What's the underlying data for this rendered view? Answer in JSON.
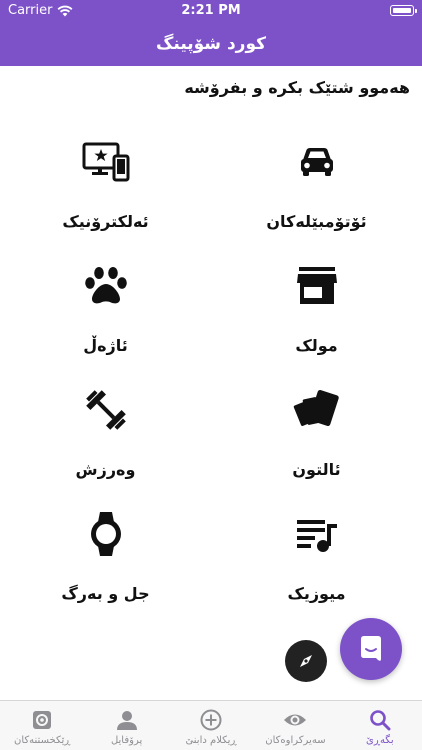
{
  "status_bar": {
    "carrier": "Carrier",
    "time": "2:21 PM"
  },
  "nav": {
    "title": "کورد شۆپینگ"
  },
  "subtitle": "هەموو شتێک بکرە و بفرۆشە",
  "categories": [
    {
      "label": "ئۆتۆمبێلەکان",
      "icon": "car-icon"
    },
    {
      "label": "ئەلکترۆنیک",
      "icon": "devices-icon"
    },
    {
      "label": "مولک",
      "icon": "store-icon"
    },
    {
      "label": "ئاژەڵ",
      "icon": "paw-icon"
    },
    {
      "label": "ئالتون",
      "icon": "gold-icon"
    },
    {
      "label": "وەرزش",
      "icon": "dumbbell-icon"
    },
    {
      "label": "میوزیک",
      "icon": "music-icon"
    },
    {
      "label": "جل و بەرگ",
      "icon": "watch-icon"
    }
  ],
  "tabs": [
    {
      "label": "بگەڕێ",
      "icon": "search-icon",
      "active": true
    },
    {
      "label": "سەیرکراوەکان",
      "icon": "eye-icon",
      "active": false
    },
    {
      "label": "ڕیکلام دابنێ",
      "icon": "add-circle-icon",
      "active": false
    },
    {
      "label": "پرۆفایل",
      "icon": "person-icon",
      "active": false
    },
    {
      "label": "ڕێکخستنەکان",
      "icon": "settings-icon",
      "active": false
    }
  ],
  "colors": {
    "brand": "#7d52c9",
    "tab_inactive": "#8e8e93"
  }
}
